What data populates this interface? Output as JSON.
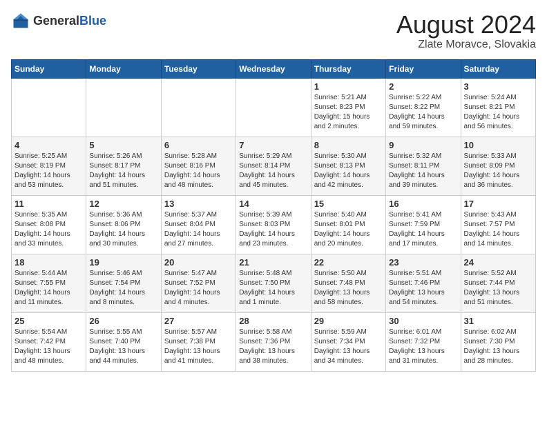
{
  "logo": {
    "general": "General",
    "blue": "Blue"
  },
  "header": {
    "title": "August 2024",
    "subtitle": "Zlate Moravce, Slovakia"
  },
  "weekdays": [
    "Sunday",
    "Monday",
    "Tuesday",
    "Wednesday",
    "Thursday",
    "Friday",
    "Saturday"
  ],
  "weeks": [
    [
      {
        "day": "",
        "info": ""
      },
      {
        "day": "",
        "info": ""
      },
      {
        "day": "",
        "info": ""
      },
      {
        "day": "",
        "info": ""
      },
      {
        "day": "1",
        "info": "Sunrise: 5:21 AM\nSunset: 8:23 PM\nDaylight: 15 hours\nand 2 minutes."
      },
      {
        "day": "2",
        "info": "Sunrise: 5:22 AM\nSunset: 8:22 PM\nDaylight: 14 hours\nand 59 minutes."
      },
      {
        "day": "3",
        "info": "Sunrise: 5:24 AM\nSunset: 8:21 PM\nDaylight: 14 hours\nand 56 minutes."
      }
    ],
    [
      {
        "day": "4",
        "info": "Sunrise: 5:25 AM\nSunset: 8:19 PM\nDaylight: 14 hours\nand 53 minutes."
      },
      {
        "day": "5",
        "info": "Sunrise: 5:26 AM\nSunset: 8:17 PM\nDaylight: 14 hours\nand 51 minutes."
      },
      {
        "day": "6",
        "info": "Sunrise: 5:28 AM\nSunset: 8:16 PM\nDaylight: 14 hours\nand 48 minutes."
      },
      {
        "day": "7",
        "info": "Sunrise: 5:29 AM\nSunset: 8:14 PM\nDaylight: 14 hours\nand 45 minutes."
      },
      {
        "day": "8",
        "info": "Sunrise: 5:30 AM\nSunset: 8:13 PM\nDaylight: 14 hours\nand 42 minutes."
      },
      {
        "day": "9",
        "info": "Sunrise: 5:32 AM\nSunset: 8:11 PM\nDaylight: 14 hours\nand 39 minutes."
      },
      {
        "day": "10",
        "info": "Sunrise: 5:33 AM\nSunset: 8:09 PM\nDaylight: 14 hours\nand 36 minutes."
      }
    ],
    [
      {
        "day": "11",
        "info": "Sunrise: 5:35 AM\nSunset: 8:08 PM\nDaylight: 14 hours\nand 33 minutes."
      },
      {
        "day": "12",
        "info": "Sunrise: 5:36 AM\nSunset: 8:06 PM\nDaylight: 14 hours\nand 30 minutes."
      },
      {
        "day": "13",
        "info": "Sunrise: 5:37 AM\nSunset: 8:04 PM\nDaylight: 14 hours\nand 27 minutes."
      },
      {
        "day": "14",
        "info": "Sunrise: 5:39 AM\nSunset: 8:03 PM\nDaylight: 14 hours\nand 23 minutes."
      },
      {
        "day": "15",
        "info": "Sunrise: 5:40 AM\nSunset: 8:01 PM\nDaylight: 14 hours\nand 20 minutes."
      },
      {
        "day": "16",
        "info": "Sunrise: 5:41 AM\nSunset: 7:59 PM\nDaylight: 14 hours\nand 17 minutes."
      },
      {
        "day": "17",
        "info": "Sunrise: 5:43 AM\nSunset: 7:57 PM\nDaylight: 14 hours\nand 14 minutes."
      }
    ],
    [
      {
        "day": "18",
        "info": "Sunrise: 5:44 AM\nSunset: 7:55 PM\nDaylight: 14 hours\nand 11 minutes."
      },
      {
        "day": "19",
        "info": "Sunrise: 5:46 AM\nSunset: 7:54 PM\nDaylight: 14 hours\nand 8 minutes."
      },
      {
        "day": "20",
        "info": "Sunrise: 5:47 AM\nSunset: 7:52 PM\nDaylight: 14 hours\nand 4 minutes."
      },
      {
        "day": "21",
        "info": "Sunrise: 5:48 AM\nSunset: 7:50 PM\nDaylight: 14 hours\nand 1 minute."
      },
      {
        "day": "22",
        "info": "Sunrise: 5:50 AM\nSunset: 7:48 PM\nDaylight: 13 hours\nand 58 minutes."
      },
      {
        "day": "23",
        "info": "Sunrise: 5:51 AM\nSunset: 7:46 PM\nDaylight: 13 hours\nand 54 minutes."
      },
      {
        "day": "24",
        "info": "Sunrise: 5:52 AM\nSunset: 7:44 PM\nDaylight: 13 hours\nand 51 minutes."
      }
    ],
    [
      {
        "day": "25",
        "info": "Sunrise: 5:54 AM\nSunset: 7:42 PM\nDaylight: 13 hours\nand 48 minutes."
      },
      {
        "day": "26",
        "info": "Sunrise: 5:55 AM\nSunset: 7:40 PM\nDaylight: 13 hours\nand 44 minutes."
      },
      {
        "day": "27",
        "info": "Sunrise: 5:57 AM\nSunset: 7:38 PM\nDaylight: 13 hours\nand 41 minutes."
      },
      {
        "day": "28",
        "info": "Sunrise: 5:58 AM\nSunset: 7:36 PM\nDaylight: 13 hours\nand 38 minutes."
      },
      {
        "day": "29",
        "info": "Sunrise: 5:59 AM\nSunset: 7:34 PM\nDaylight: 13 hours\nand 34 minutes."
      },
      {
        "day": "30",
        "info": "Sunrise: 6:01 AM\nSunset: 7:32 PM\nDaylight: 13 hours\nand 31 minutes."
      },
      {
        "day": "31",
        "info": "Sunrise: 6:02 AM\nSunset: 7:30 PM\nDaylight: 13 hours\nand 28 minutes."
      }
    ]
  ]
}
